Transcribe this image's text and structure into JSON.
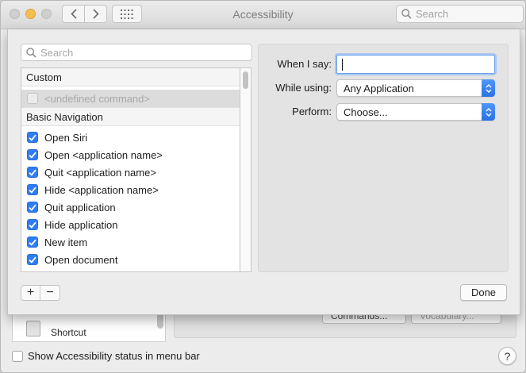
{
  "window": {
    "title": "Accessibility",
    "search_placeholder": "Search"
  },
  "sheet": {
    "search_placeholder": "Search",
    "sections": [
      {
        "header": "Custom"
      },
      {
        "header": "Basic Navigation"
      }
    ],
    "undefined_command": "<undefined command>",
    "commands": [
      {
        "label": "Open Siri",
        "checked": true
      },
      {
        "label": "Open <application name>",
        "checked": true
      },
      {
        "label": "Quit <application name>",
        "checked": true
      },
      {
        "label": "Hide <application name>",
        "checked": true
      },
      {
        "label": "Quit application",
        "checked": true
      },
      {
        "label": "Hide application",
        "checked": true
      },
      {
        "label": "New item",
        "checked": true
      },
      {
        "label": "Open document",
        "checked": true
      }
    ],
    "detail": {
      "when_i_say_label": "When I say:",
      "when_i_say_value": "",
      "while_using_label": "While using:",
      "while_using_value": "Any Application",
      "perform_label": "Perform:",
      "perform_value": "Choose..."
    },
    "add_label": "+",
    "remove_label": "−",
    "done_label": "Done"
  },
  "background": {
    "list_item": "Shortcut",
    "commands_button": "Commands...",
    "vocabulary_button": "Vocabulary...",
    "status_checkbox_label": "Show Accessibility status in menu bar",
    "status_checked": false,
    "help_label": "?"
  },
  "colors": {
    "accent": "#2f7df6",
    "minimize": "#f5bf4f"
  }
}
